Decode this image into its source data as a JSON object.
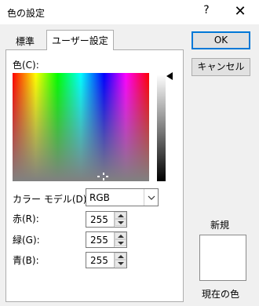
{
  "window": {
    "title": "色の設定",
    "help_glyph": "?",
    "close_glyph": "✕"
  },
  "tabs": [
    {
      "label": "標準"
    },
    {
      "label": "ユーザー設定"
    }
  ],
  "color_label": "色(C):",
  "color_model": {
    "label": "カラー モデル(D):",
    "value": "RGB"
  },
  "channels": {
    "red": {
      "label": "赤(R):",
      "value": "255"
    },
    "green": {
      "label": "緑(G):",
      "value": "255"
    },
    "blue": {
      "label": "青(B):",
      "value": "255"
    }
  },
  "buttons": {
    "ok": "OK",
    "cancel": "キャンセル"
  },
  "preview": {
    "new_label": "新規",
    "current_label": "現在の色",
    "color": "#ffffff"
  }
}
